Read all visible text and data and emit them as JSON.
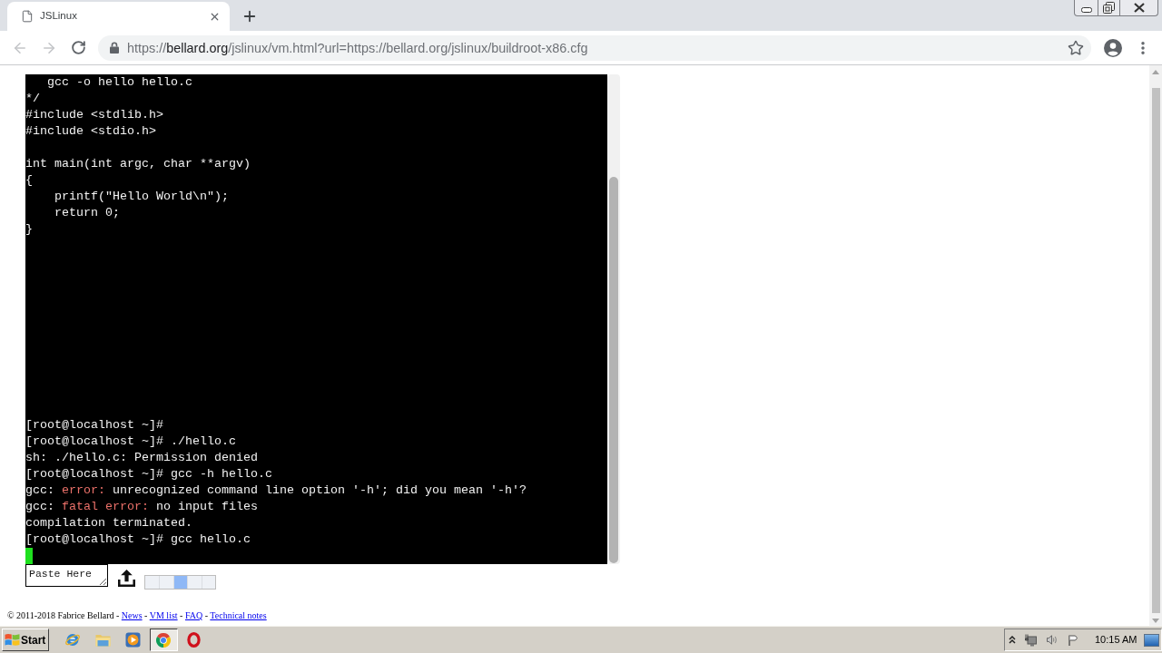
{
  "browser": {
    "tabs": [
      {
        "title": "JSLinux",
        "selected": true
      }
    ],
    "toolbar": {
      "back": {
        "disabled": true
      },
      "forward": {
        "disabled": true
      }
    },
    "address_bar": {
      "segments": [
        {
          "text": "https://",
          "kind": "dim"
        },
        {
          "text": "bellard.org",
          "kind": "host"
        },
        {
          "text": "/jslinux/vm.html?url=https://bellard.org/jslinux/buildroot-x86.cfg",
          "kind": "dim"
        }
      ]
    }
  },
  "terminal": {
    "blocks": [
      [
        "   gcc -o hello hello.c",
        "*/",
        "#include <stdlib.h>",
        "#include <stdio.h>"
      ],
      [
        "int main(int argc, char **argv)",
        "{",
        "    printf(\"Hello World\\n\");",
        "    return 0;",
        "}"
      ]
    ],
    "session": [
      {
        "segments": [
          {
            "text": "[root@localhost ~]#",
            "kind": "plain"
          }
        ]
      },
      {
        "segments": [
          {
            "text": "[root@localhost ~]# ./hello.c",
            "kind": "plain"
          }
        ]
      },
      {
        "segments": [
          {
            "text": "sh: ./hello.c: Permission denied",
            "kind": "plain"
          }
        ]
      },
      {
        "segments": [
          {
            "text": "[root@localhost ~]# gcc -h hello.c",
            "kind": "plain"
          }
        ]
      },
      {
        "segments": [
          {
            "text": "gcc: ",
            "kind": "plain"
          },
          {
            "text": "error:",
            "kind": "error"
          },
          {
            "text": " unrecognized command line option '-h'; did you mean '-h'?",
            "kind": "plain"
          }
        ]
      },
      {
        "segments": [
          {
            "text": "gcc: ",
            "kind": "plain"
          },
          {
            "text": "fatal error:",
            "kind": "error"
          },
          {
            "text": " no input files",
            "kind": "plain"
          }
        ]
      },
      {
        "segments": [
          {
            "text": "compilation terminated.",
            "kind": "plain"
          }
        ]
      },
      {
        "segments": [
          {
            "text": "[root@localhost ~]# gcc hello.c",
            "kind": "plain"
          }
        ]
      }
    ]
  },
  "paste_box": {
    "placeholder": "Paste Here"
  },
  "activity_bar": [
    {
      "on": false
    },
    {
      "on": false
    },
    {
      "on": true
    },
    {
      "on": false
    },
    {
      "on": false
    }
  ],
  "footer": [
    {
      "text": "© 2011-2018 Fabrice Bellard - ",
      "kind": "text"
    },
    {
      "text": "News",
      "kind": "link"
    },
    {
      "text": " - ",
      "kind": "text"
    },
    {
      "text": "VM list",
      "kind": "link"
    },
    {
      "text": " - ",
      "kind": "text"
    },
    {
      "text": "FAQ",
      "kind": "link"
    },
    {
      "text": " - ",
      "kind": "text"
    },
    {
      "text": "Technical notes",
      "kind": "link"
    }
  ],
  "taskbar": {
    "start": "Start",
    "apps": [
      {
        "selected": false
      },
      {
        "selected": false
      },
      {
        "selected": false
      },
      {
        "selected": true
      },
      {
        "selected": false
      }
    ],
    "clock": "10:15 AM"
  }
}
